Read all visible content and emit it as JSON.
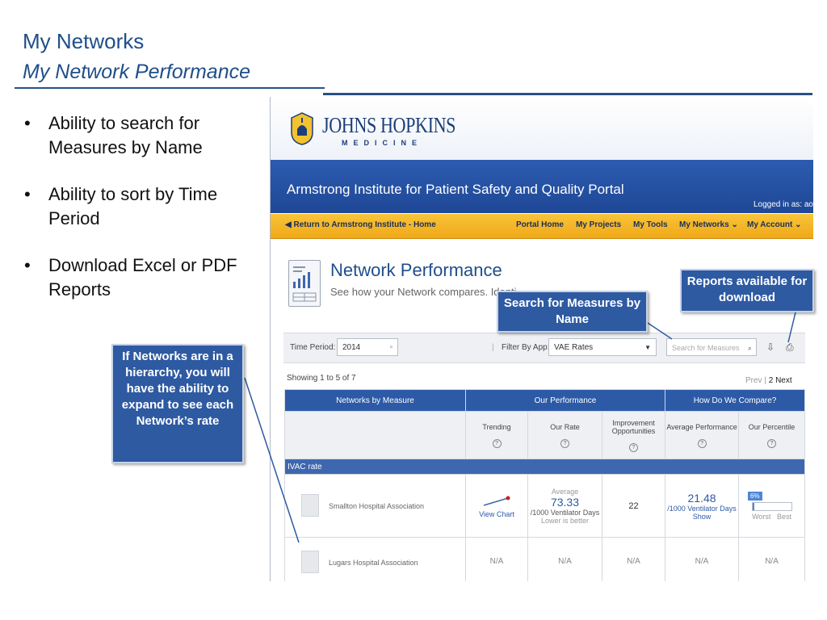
{
  "slide": {
    "title": "My Networks",
    "subtitle": "My Network Performance",
    "bullets": [
      "Ability to search for Measures by Name",
      "Ability to sort by Time Period",
      "Download Excel or PDF Reports"
    ]
  },
  "callouts": {
    "left": "If Networks are in a hierarchy, you will have the ability to expand to see each Network’s rate",
    "search": "Search for Measures by Name",
    "reports": "Reports available for download"
  },
  "portal": {
    "logo_main": "JOHNS HOPKINS",
    "logo_sub": "MEDICINE",
    "banner_title": "Armstrong Institute for Patient Safety and Quality Portal",
    "logged_in": "Logged in as: aor",
    "nav": {
      "back": "Return to Armstrong Institute - Home",
      "home": "Portal Home",
      "projects": "My Projects",
      "tools": "My Tools",
      "networks": "My Networks",
      "account": "My Account"
    },
    "page_title": "Network Performance",
    "page_subtitle": "See how your Network compares. Identi",
    "filters": {
      "time_period_label": "Time Period:",
      "time_period_value": "2014",
      "app_label": "Filter By App:",
      "app_value": "VAE Rates",
      "search_placeholder": "Search for Measures"
    },
    "showing": "Showing 1 to 5 of 7",
    "pager": {
      "prev": "Prev",
      "sep": "|",
      "page": "2",
      "next": "Next"
    },
    "table": {
      "group_headers": [
        "Networks by Measure",
        "Our Performance",
        "How Do We Compare?"
      ],
      "columns": [
        "Trending",
        "Our Rate",
        "Improvement Opportunities",
        "Average Performance",
        "Our Percentile"
      ],
      "group_row": "IVAC rate",
      "rows": [
        {
          "network": "Smallton Hospital Association",
          "trending": "View Chart",
          "rate_label": "Average",
          "rate": "73.33",
          "rate_unit": "/1000 Ventilator Days",
          "rate_note": "Lower is better",
          "opportunities": "22",
          "avg": "21.48",
          "avg_unit": "/1000 Ventilator Days",
          "avg_link": "Show",
          "percentile": "6%",
          "percentile_value": 0.06,
          "worst": "Worst",
          "best": "Best"
        },
        {
          "network": "Lugars Hospital Association",
          "trending": "N/A",
          "rate": "N/A",
          "opportunities": "N/A",
          "avg": "N/A",
          "percentile": "N/A"
        }
      ]
    }
  }
}
